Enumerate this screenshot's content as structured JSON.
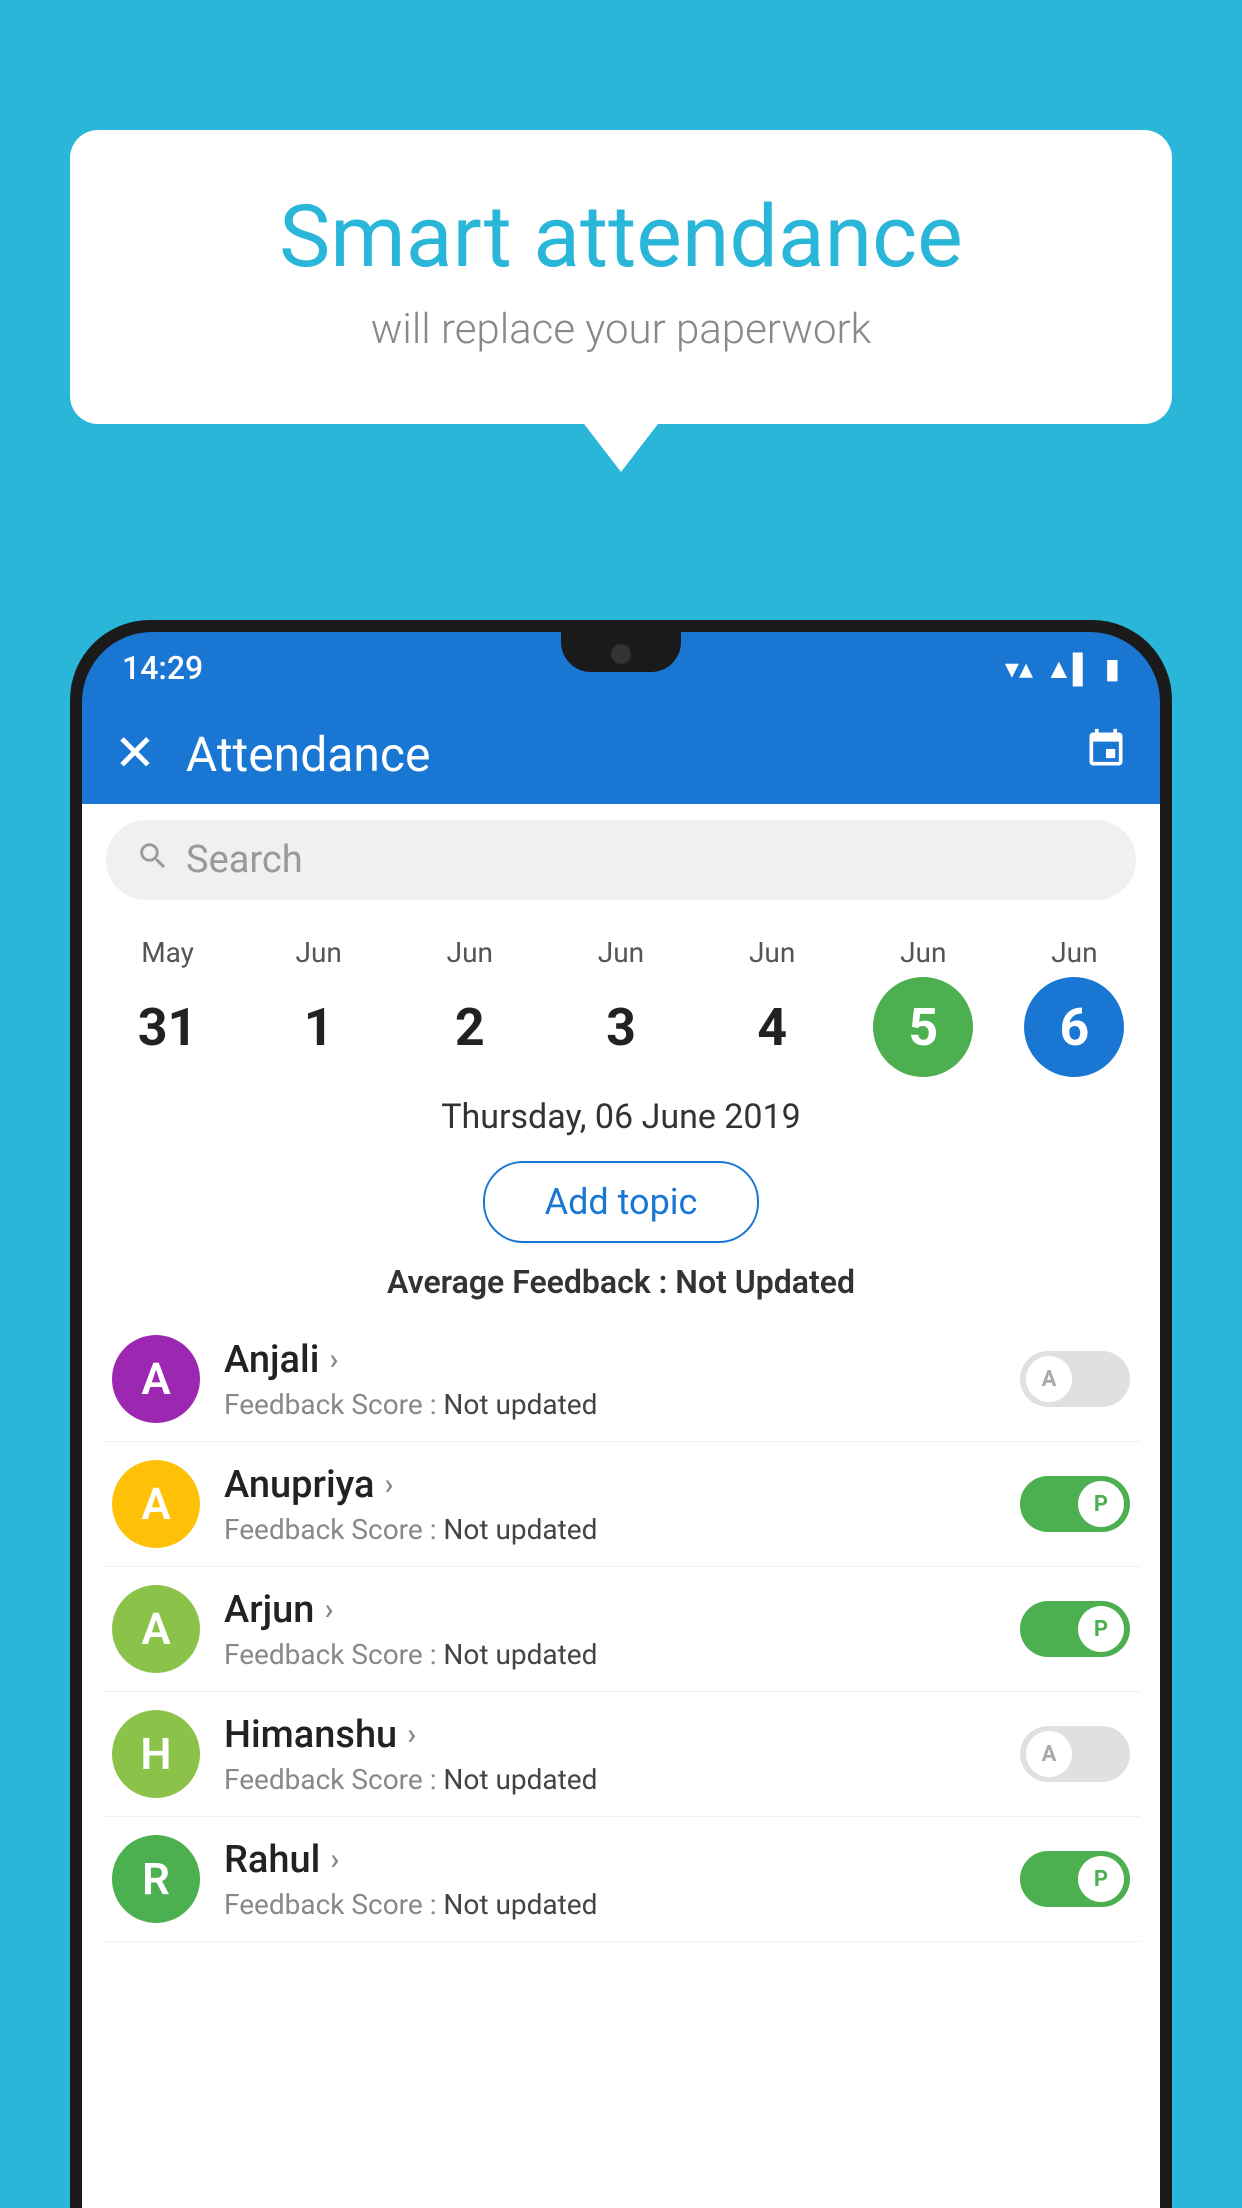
{
  "background_color": "#29b6d8",
  "hero": {
    "title": "Smart attendance",
    "subtitle": "will replace your paperwork"
  },
  "phone": {
    "status_bar": {
      "time": "14:29",
      "wifi": "wifi",
      "signal": "signal",
      "battery": "battery"
    },
    "app_bar": {
      "title": "Attendance",
      "close_icon": "×",
      "calendar_icon": "📅"
    },
    "search": {
      "placeholder": "Search"
    },
    "calendar": {
      "days": [
        {
          "month": "May",
          "num": "31",
          "state": "normal"
        },
        {
          "month": "Jun",
          "num": "1",
          "state": "normal"
        },
        {
          "month": "Jun",
          "num": "2",
          "state": "normal"
        },
        {
          "month": "Jun",
          "num": "3",
          "state": "normal"
        },
        {
          "month": "Jun",
          "num": "4",
          "state": "normal"
        },
        {
          "month": "Jun",
          "num": "5",
          "state": "today"
        },
        {
          "month": "Jun",
          "num": "6",
          "state": "selected"
        }
      ]
    },
    "selected_date": "Thursday, 06 June 2019",
    "add_topic_label": "Add topic",
    "avg_feedback_label": "Average Feedback :",
    "avg_feedback_value": "Not Updated",
    "students": [
      {
        "name": "Anjali",
        "avatar_letter": "A",
        "avatar_color": "#9c27b0",
        "feedback_label": "Feedback Score :",
        "feedback_value": "Not updated",
        "toggle_state": "off",
        "toggle_label": "A"
      },
      {
        "name": "Anupriya",
        "avatar_letter": "A",
        "avatar_color": "#ffc107",
        "feedback_label": "Feedback Score :",
        "feedback_value": "Not updated",
        "toggle_state": "on",
        "toggle_label": "P"
      },
      {
        "name": "Arjun",
        "avatar_letter": "A",
        "avatar_color": "#8bc34a",
        "feedback_label": "Feedback Score :",
        "feedback_value": "Not updated",
        "toggle_state": "on",
        "toggle_label": "P"
      },
      {
        "name": "Himanshu",
        "avatar_letter": "H",
        "avatar_color": "#8bc34a",
        "feedback_label": "Feedback Score :",
        "feedback_value": "Not updated",
        "toggle_state": "off",
        "toggle_label": "A"
      },
      {
        "name": "Rahul",
        "avatar_letter": "R",
        "avatar_color": "#4caf50",
        "feedback_label": "Feedback Score :",
        "feedback_value": "Not updated",
        "toggle_state": "on",
        "toggle_label": "P"
      }
    ]
  }
}
